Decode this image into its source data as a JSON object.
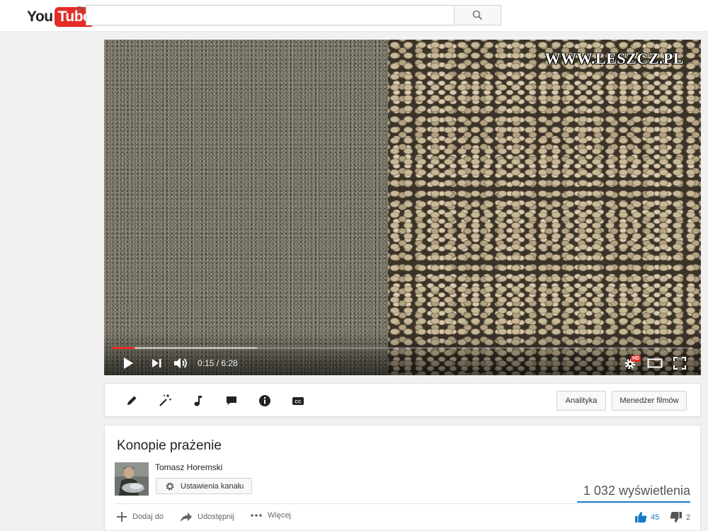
{
  "masthead": {
    "logo_you": "You",
    "logo_tube": "Tube",
    "region": "PL",
    "search_value": "",
    "search_placeholder": ""
  },
  "player": {
    "watermark": "WWW.LESZCZ.PL",
    "time_current": "0:15",
    "time_separator": " / ",
    "time_total": "6:28",
    "played_fraction": 0.039,
    "buffered_fraction": 0.25,
    "quality_badge": "HD",
    "accent_color": "#e52d27"
  },
  "toolbar": {
    "icons": [
      "pencil-icon",
      "magic-wand-icon",
      "music-note-icon",
      "annotation-icon",
      "info-icon",
      "cc-icon"
    ],
    "analytics_label": "Analityka",
    "video_manager_label": "Menedżer filmów"
  },
  "video": {
    "title": "Konopie prażenie",
    "channel_name": "Tomasz Horemski",
    "channel_settings_label": "Ustawienia kanału",
    "views": "1 032 wyświetlenia",
    "add_to_label": "Dodaj do",
    "share_label": "Udostępnij",
    "more_label": "Więcej",
    "likes": "45",
    "dislikes": "2",
    "like_color": "#167ac6"
  }
}
